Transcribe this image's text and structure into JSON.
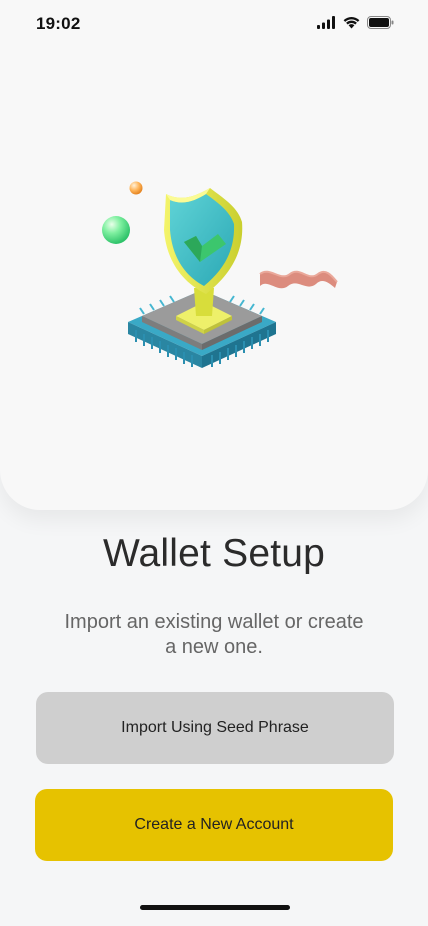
{
  "status_bar": {
    "time": "19:02"
  },
  "illustration": {
    "description_icon": "shield-chip-icon"
  },
  "main": {
    "title": "Wallet Setup",
    "subtitle": "Import an existing wallet or create a new one."
  },
  "actions": {
    "import_label": "Import Using Seed Phrase",
    "create_label": "Create a New Account"
  },
  "colors": {
    "primary": "#e6c200",
    "secondary": "#cfcfcf",
    "background": "#f5f6f7"
  }
}
